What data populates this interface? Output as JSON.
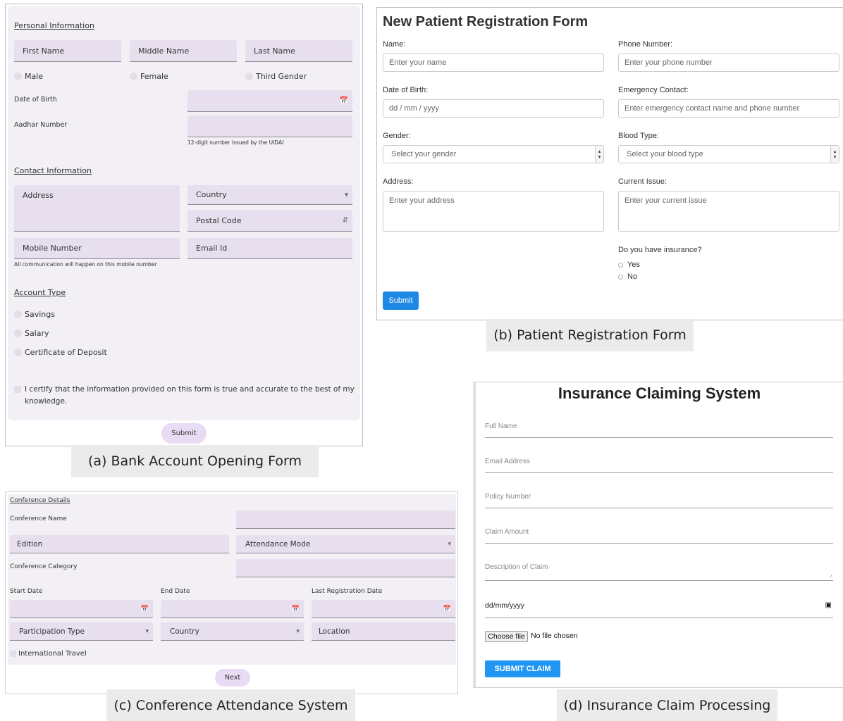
{
  "bank": {
    "section_personal": "Personal Information",
    "first_name": "First Name",
    "middle_name": "Middle Name",
    "last_name": "Last Name",
    "gender_options": [
      "Male",
      "Female",
      "Third Gender"
    ],
    "dob_label": "Date of Birth",
    "aadhar_label": "Aadhar Number",
    "aadhar_help": "12-digit number issued by the UIDAI",
    "section_contact": "Contact Information",
    "address": "Address",
    "country": "Country",
    "postal_code": "Postal Code",
    "mobile": "Mobile Number",
    "email": "Email Id",
    "mobile_help": "All communication will happen on this mobile number",
    "section_account": "Account Type",
    "account_options": [
      "Savings",
      "Salary",
      "Certificate of Deposit"
    ],
    "certify_line1": "I certify that the information provided on this form is true and accurate to the best of my",
    "certify_line2": "knowledge.",
    "submit": "Submit",
    "caption": "(a) Bank Account Opening Form"
  },
  "patient": {
    "title": "New Patient Registration Form",
    "name_label": "Name:",
    "name_ph": "Enter your name",
    "phone_label": "Phone Number:",
    "phone_ph": "Enter your phone number",
    "dob_label": "Date of Birth:",
    "dob_ph": "dd / mm / yyyy",
    "emergency_label": "Emergency Contact:",
    "emergency_ph": "Enter emergency contact name and phone number",
    "gender_label": "Gender:",
    "gender_ph": "Select your gender",
    "blood_label": "Blood Type:",
    "blood_ph": "Select your blood type",
    "address_label": "Address:",
    "address_ph": "Enter your address",
    "issue_label": "Current Issue:",
    "issue_ph": "Enter your current issue",
    "insurance_q": "Do you have insurance?",
    "yes": "Yes",
    "no": "No",
    "submit": "Submit",
    "caption": "(b) Patient Registration Form"
  },
  "conference": {
    "section": "Conference Details",
    "name_label": "Conference Name",
    "edition": "Edition",
    "attendance_mode": "Attendance Mode",
    "category_label": "Conference Category",
    "start_date": "Start Date",
    "end_date": "End Date",
    "last_reg_date": "Last Registration Date",
    "participation_type": "Participation Type",
    "country": "Country",
    "location": "Location",
    "intl_travel": "International Travel",
    "next": "Next",
    "caption": "(c) Conference Attendance System"
  },
  "insurance": {
    "title": "Insurance Claiming System",
    "full_name": "Full Name",
    "email": "Email Address",
    "policy": "Policy Number",
    "amount": "Claim Amount",
    "description": "Description of Claim",
    "date_ph": "dd/mm/yyyy",
    "choose_file": "Choose file",
    "no_file": "No file chosen",
    "submit": "SUBMIT CLAIM",
    "caption": "(d) Insurance Claim Processing"
  },
  "icons": {
    "calendar": "calendar-icon",
    "dropdown": "dropdown-arrow-icon",
    "spinner": "number-spinner-icon",
    "resize": "resize-handle-icon"
  }
}
